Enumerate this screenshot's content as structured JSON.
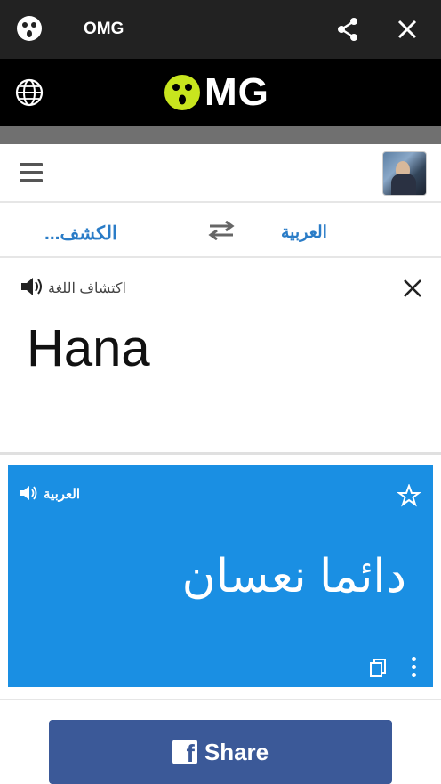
{
  "topbar": {
    "title": "OMG"
  },
  "brand": {
    "logo_text": "MG"
  },
  "nav": {},
  "languages": {
    "source": "الكشف...",
    "target": "العربية"
  },
  "source_panel": {
    "label": "اكتشاف اللغة",
    "text": "Hana"
  },
  "result_panel": {
    "label": "العربية",
    "text": "دائما نعسان"
  },
  "share_button": {
    "label": "Share"
  },
  "colors": {
    "topbar": "#222222",
    "brandbar": "#000000",
    "logo_accent": "#c8e51e",
    "link_blue": "#2a7cc7",
    "result_bg": "#1a8fe3",
    "facebook_blue": "#3b5998"
  }
}
